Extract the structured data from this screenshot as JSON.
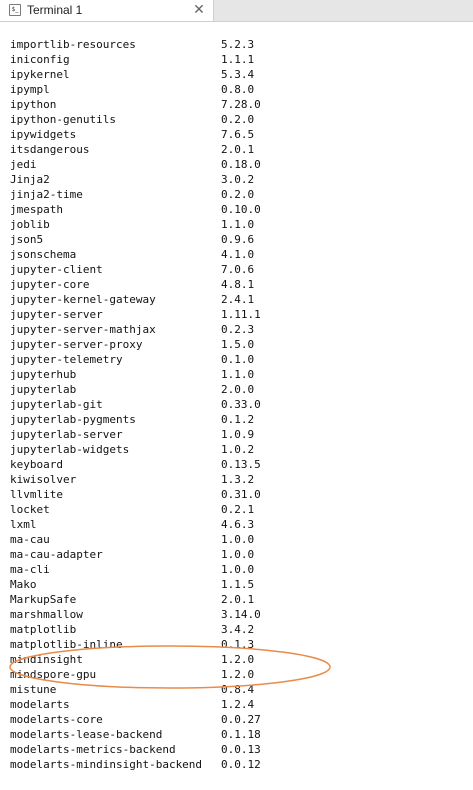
{
  "tab": {
    "icon": "terminal-icon",
    "title": "Terminal 1",
    "close_glyph": "✕"
  },
  "annotation": {
    "shape": "ellipse",
    "color": "#e98b4a",
    "encloses": [
      "mindinsight",
      "mindspore-gpu"
    ]
  },
  "packages": [
    {
      "name": "importlib-resources",
      "version": "5.2.3"
    },
    {
      "name": "iniconfig",
      "version": "1.1.1"
    },
    {
      "name": "ipykernel",
      "version": "5.3.4"
    },
    {
      "name": "ipympl",
      "version": "0.8.0"
    },
    {
      "name": "ipython",
      "version": "7.28.0"
    },
    {
      "name": "ipython-genutils",
      "version": "0.2.0"
    },
    {
      "name": "ipywidgets",
      "version": "7.6.5"
    },
    {
      "name": "itsdangerous",
      "version": "2.0.1"
    },
    {
      "name": "jedi",
      "version": "0.18.0"
    },
    {
      "name": "Jinja2",
      "version": "3.0.2"
    },
    {
      "name": "jinja2-time",
      "version": "0.2.0"
    },
    {
      "name": "jmespath",
      "version": "0.10.0"
    },
    {
      "name": "joblib",
      "version": "1.1.0"
    },
    {
      "name": "json5",
      "version": "0.9.6"
    },
    {
      "name": "jsonschema",
      "version": "4.1.0"
    },
    {
      "name": "jupyter-client",
      "version": "7.0.6"
    },
    {
      "name": "jupyter-core",
      "version": "4.8.1"
    },
    {
      "name": "jupyter-kernel-gateway",
      "version": "2.4.1"
    },
    {
      "name": "jupyter-server",
      "version": "1.11.1"
    },
    {
      "name": "jupyter-server-mathjax",
      "version": "0.2.3"
    },
    {
      "name": "jupyter-server-proxy",
      "version": "1.5.0"
    },
    {
      "name": "jupyter-telemetry",
      "version": "0.1.0"
    },
    {
      "name": "jupyterhub",
      "version": "1.1.0"
    },
    {
      "name": "jupyterlab",
      "version": "2.0.0"
    },
    {
      "name": "jupyterlab-git",
      "version": "0.33.0"
    },
    {
      "name": "jupyterlab-pygments",
      "version": "0.1.2"
    },
    {
      "name": "jupyterlab-server",
      "version": "1.0.9"
    },
    {
      "name": "jupyterlab-widgets",
      "version": "1.0.2"
    },
    {
      "name": "keyboard",
      "version": "0.13.5"
    },
    {
      "name": "kiwisolver",
      "version": "1.3.2"
    },
    {
      "name": "llvmlite",
      "version": "0.31.0"
    },
    {
      "name": "locket",
      "version": "0.2.1"
    },
    {
      "name": "lxml",
      "version": "4.6.3"
    },
    {
      "name": "ma-cau",
      "version": "1.0.0"
    },
    {
      "name": "ma-cau-adapter",
      "version": "1.0.0"
    },
    {
      "name": "ma-cli",
      "version": "1.0.0"
    },
    {
      "name": "Mako",
      "version": "1.1.5"
    },
    {
      "name": "MarkupSafe",
      "version": "2.0.1"
    },
    {
      "name": "marshmallow",
      "version": "3.14.0"
    },
    {
      "name": "matplotlib",
      "version": "3.4.2"
    },
    {
      "name": "matplotlib-inline",
      "version": "0.1.3"
    },
    {
      "name": "mindinsight",
      "version": "1.2.0"
    },
    {
      "name": "mindspore-gpu",
      "version": "1.2.0"
    },
    {
      "name": "mistune",
      "version": "0.8.4"
    },
    {
      "name": "modelarts",
      "version": "1.2.4"
    },
    {
      "name": "modelarts-core",
      "version": "0.0.27"
    },
    {
      "name": "modelarts-lease-backend",
      "version": "0.1.18"
    },
    {
      "name": "modelarts-metrics-backend",
      "version": "0.0.13"
    },
    {
      "name": "modelarts-mindinsight-backend",
      "version": "0.0.12"
    }
  ]
}
